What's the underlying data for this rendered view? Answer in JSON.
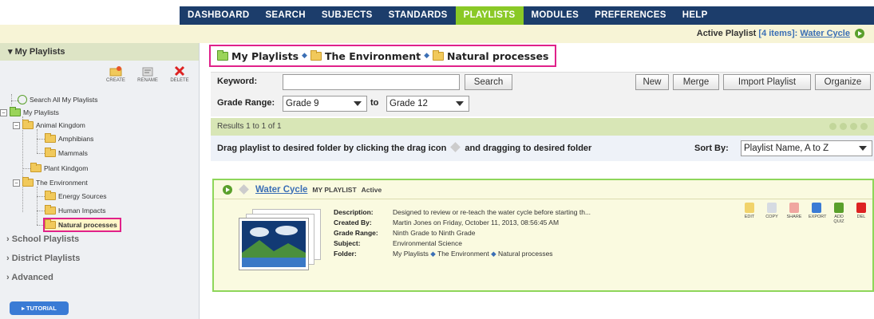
{
  "nav": {
    "items": [
      "DASHBOARD",
      "SEARCH",
      "SUBJECTS",
      "STANDARDS",
      "PLAYLISTS",
      "MODULES",
      "PREFERENCES",
      "HELP"
    ],
    "active": "PLAYLISTS"
  },
  "active_playlist": {
    "label": "Active Playlist",
    "items": "[4 items]:",
    "name": "Water Cycle"
  },
  "sidebar": {
    "title": "My Playlists",
    "actions": [
      "CREATE",
      "RENAME",
      "DELETE"
    ],
    "tree": {
      "search_all": "Search All My Playlists",
      "my_playlists": "My Playlists",
      "animal_kingdom": "Animal Kingdom",
      "amphibians": "Amphibians",
      "mammals": "Mammals",
      "plant_kingdom": "Plant Kindgom",
      "environment": "The Environment",
      "energy_sources": "Energy Sources",
      "human_impacts": "Human Impacts",
      "natural_processes": "Natural processes"
    },
    "sections": [
      "School Playlists",
      "District Playlists",
      "Advanced"
    ],
    "tutorial": "TUTORIAL"
  },
  "breadcrumb": [
    "My Playlists",
    "The Environment",
    "Natural processes"
  ],
  "search": {
    "keyword_label": "Keyword:",
    "keyword_value": "",
    "search_button": "Search",
    "grade_label": "Grade Range:",
    "grade_from": "Grade 9",
    "to_label": "to",
    "grade_to": "Grade 12",
    "buttons": [
      "New",
      "Merge",
      "Import Playlist",
      "Organize"
    ]
  },
  "results": {
    "text": "Results 1 to 1 of 1"
  },
  "drag": {
    "text_before": "Drag playlist to desired folder by clicking the drag icon",
    "text_after": "and dragging to desired folder",
    "sort_label": "Sort By:",
    "sort_value": "Playlist Name, A to Z"
  },
  "playlist": {
    "title": "Water Cycle",
    "type": "MY PLAYLIST",
    "status": "Active",
    "description_label": "Description:",
    "description": "Designed to review or re-teach the water cycle before starting th...",
    "created_label": "Created By:",
    "created": "Martin Jones on Friday, October 11, 2013, 08:56:45 AM",
    "grade_label": "Grade Range:",
    "grade": "Ninth Grade to Ninth Grade",
    "subject_label": "Subject:",
    "subject": "Environmental Science",
    "folder_label": "Folder:",
    "folder_path": [
      "My Playlists",
      "The Environment",
      "Natural processes"
    ],
    "actions": [
      "EDIT",
      "COPY",
      "SHARE",
      "EXPORT",
      "ADD QUIZ",
      "DEL"
    ]
  },
  "colors": {
    "nav_bg": "#1c3d6b",
    "nav_active": "#8ac926",
    "highlight": "#e0218a",
    "link": "#3b6fb5"
  }
}
